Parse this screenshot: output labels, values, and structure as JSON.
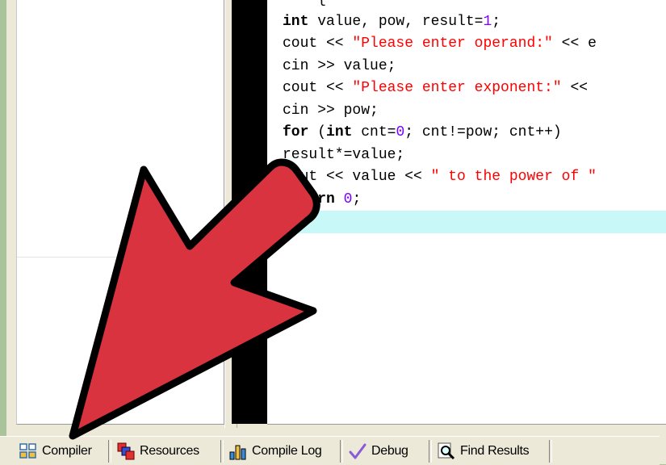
{
  "code": {
    "lines": [
      [
        {
          "t": "    {",
          "c": "plain"
        }
      ],
      [
        {
          "t": "int",
          "c": "kw"
        },
        {
          "t": " value, pow, result=",
          "c": "plain"
        },
        {
          "t": "1",
          "c": "num"
        },
        {
          "t": ";",
          "c": "plain"
        }
      ],
      [
        {
          "t": "cout << ",
          "c": "plain"
        },
        {
          "t": "\"Please enter operand:\"",
          "c": "str"
        },
        {
          "t": " << e",
          "c": "plain"
        }
      ],
      [
        {
          "t": "cin >> value;",
          "c": "plain"
        }
      ],
      [
        {
          "t": "cout << ",
          "c": "plain"
        },
        {
          "t": "\"Please enter exponent:\"",
          "c": "str"
        },
        {
          "t": " <<",
          "c": "plain"
        }
      ],
      [
        {
          "t": "cin >> pow;",
          "c": "plain"
        }
      ],
      [
        {
          "t": "for",
          "c": "kw"
        },
        {
          "t": " (",
          "c": "plain"
        },
        {
          "t": "int",
          "c": "kw"
        },
        {
          "t": " cnt=",
          "c": "plain"
        },
        {
          "t": "0",
          "c": "num"
        },
        {
          "t": "; cnt!=pow; cnt++)",
          "c": "plain"
        }
      ],
      [
        {
          "t": "result*=value;",
          "c": "plain"
        }
      ],
      [
        {
          "t": "cout << value << ",
          "c": "plain"
        },
        {
          "t": "\" to the power of \"",
          "c": "str"
        }
      ],
      [
        {
          "t": "return",
          "c": "kw"
        },
        {
          "t": " ",
          "c": "plain"
        },
        {
          "t": "0",
          "c": "num"
        },
        {
          "t": ";",
          "c": "plain"
        }
      ],
      [
        {
          "t": "}",
          "c": "plain"
        }
      ]
    ],
    "current_line": 10
  },
  "tabs": {
    "compiler": "Compiler",
    "resources": "Resources",
    "compile_log": "Compile Log",
    "debug": "Debug",
    "find_results": "Find Results"
  },
  "colors": {
    "keyword": "#000000",
    "string": "#ff0000",
    "number": "#8000ff",
    "current_line": "#c8f8f8",
    "arrow_fill": "#d9333f"
  }
}
